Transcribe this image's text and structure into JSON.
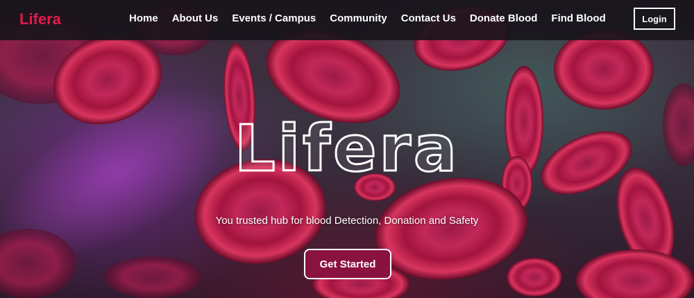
{
  "brand": {
    "name": "Lifera",
    "color": "#e5194c"
  },
  "nav": {
    "links": [
      {
        "label": "Home"
      },
      {
        "label": "About Us"
      },
      {
        "label": "Events / Campus"
      },
      {
        "label": "Community"
      },
      {
        "label": "Contact Us"
      },
      {
        "label": "Donate Blood"
      },
      {
        "label": "Find Blood"
      }
    ],
    "login_label": "Login"
  },
  "hero": {
    "title": "Lifera",
    "subtitle": "You trusted hub for blood Detection, Donation and Safety",
    "cta_label": "Get Started",
    "cta_color": "#8a1240",
    "background_image": "red-blood-cells-illustration"
  }
}
